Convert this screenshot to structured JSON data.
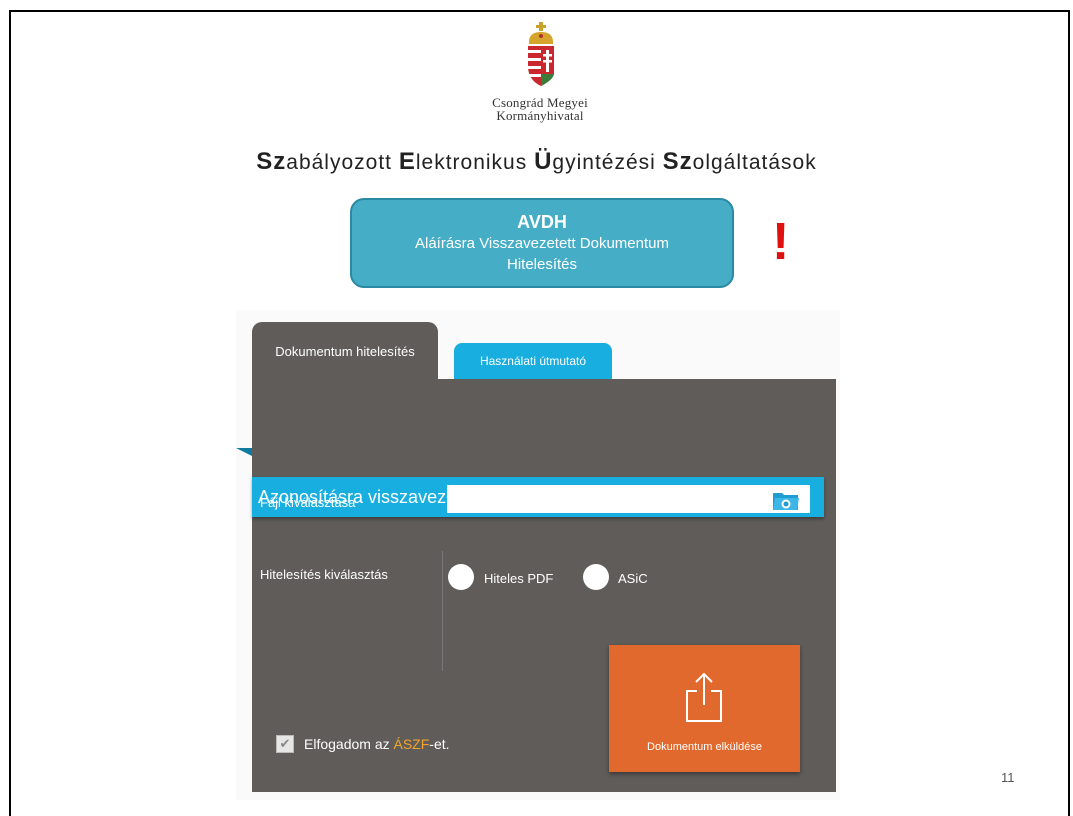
{
  "org": {
    "line1": "Csongrád Megyei",
    "line2": "Kormányhivatal"
  },
  "heading": {
    "w1_cap": "Sz",
    "w1_rest": "abályozott ",
    "w2_cap": "E",
    "w2_rest": "lektronikus ",
    "w3_cap": "Ü",
    "w3_rest": "gyintézési ",
    "w4_cap": "Sz",
    "w4_rest": "olgáltatások"
  },
  "avdh": {
    "acronym": "AVDH",
    "line2": "Aláírásra Visszavezetett Dokumentum",
    "line3": "Hitelesítés"
  },
  "alert_mark": "!",
  "tabs": [
    {
      "label": "Dokumentum hitelesítés",
      "active": true
    },
    {
      "label": "Használati útmutató",
      "active": false
    }
  ],
  "form": {
    "banner": "Azonosításra visszavezetett dokumentumhitelesítés",
    "file_label": "Fájl kiválasztása",
    "file_value": "",
    "auth_label": "Hitelesítés kiválasztás",
    "options": [
      "Hiteles PDF",
      "ASiC"
    ],
    "submit_label": "Dokumentum elküldése",
    "accept_prefix": "Elfogadom az ",
    "accept_link": "ÁSZF",
    "accept_suffix": "-et.",
    "accept_checked": true
  },
  "page_number": "11",
  "colors": {
    "accent_blue": "#19aee0",
    "panel_gray": "#5f5c59",
    "submit_orange": "#e2692d",
    "alert_red": "#e01010"
  },
  "icons": [
    "coat-of-arms-icon",
    "folder-open-icon",
    "upload-icon",
    "check-icon"
  ]
}
